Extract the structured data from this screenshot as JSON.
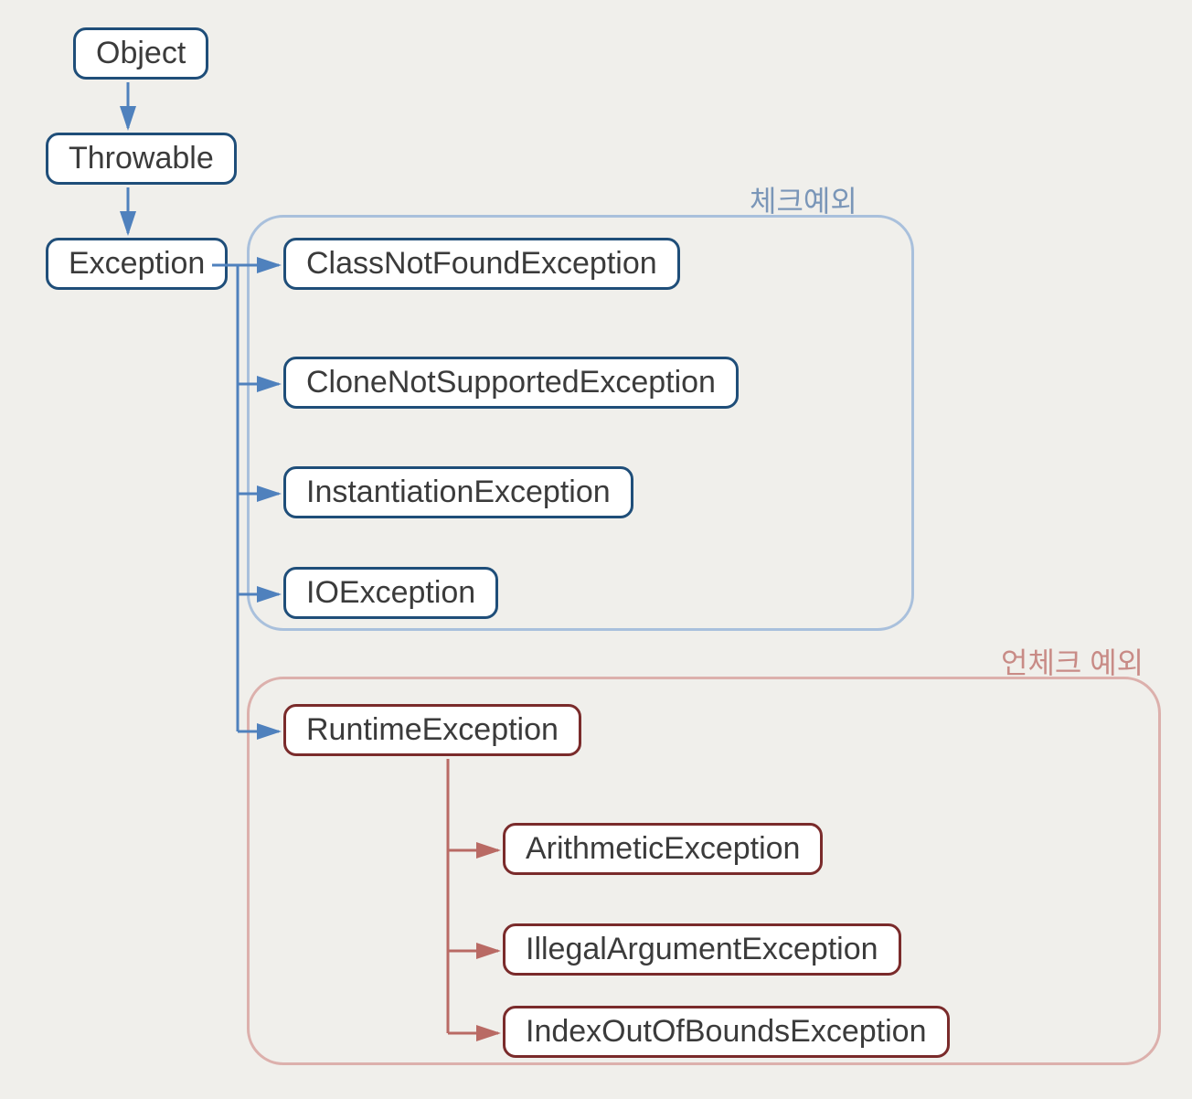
{
  "nodes": {
    "object": "Object",
    "throwable": "Throwable",
    "exception": "Exception",
    "classNotFound": "ClassNotFoundException",
    "cloneNotSupported": "CloneNotSupportedException",
    "instantiation": "InstantiationException",
    "ioexception": "IOException",
    "runtime": "RuntimeException",
    "arithmetic": "ArithmeticException",
    "illegalArg": "IllegalArgumentException",
    "indexOob": "IndexOutOfBoundsException"
  },
  "groups": {
    "checked": "체크예외",
    "unchecked": "언체크 예외"
  },
  "colors": {
    "nodeBlue": "#1f4e79",
    "nodeRed": "#7a2b2b",
    "groupBlue": "#a9c0dc",
    "groupRed": "#dcb0ac",
    "labelBlue": "#7a96b8",
    "labelRed": "#c88b86",
    "arrowBlue": "#4f81bd",
    "arrowRed": "#b96a64"
  },
  "hierarchy": {
    "root": "Object",
    "children": {
      "Object": [
        "Throwable"
      ],
      "Throwable": [
        "Exception"
      ],
      "Exception": [
        "ClassNotFoundException",
        "CloneNotSupportedException",
        "InstantiationException",
        "IOException",
        "RuntimeException"
      ],
      "RuntimeException": [
        "ArithmeticException",
        "IllegalArgumentException",
        "IndexOutOfBoundsException"
      ]
    },
    "checked": [
      "ClassNotFoundException",
      "CloneNotSupportedException",
      "InstantiationException",
      "IOException"
    ],
    "unchecked": [
      "RuntimeException",
      "ArithmeticException",
      "IllegalArgumentException",
      "IndexOutOfBoundsException"
    ]
  }
}
